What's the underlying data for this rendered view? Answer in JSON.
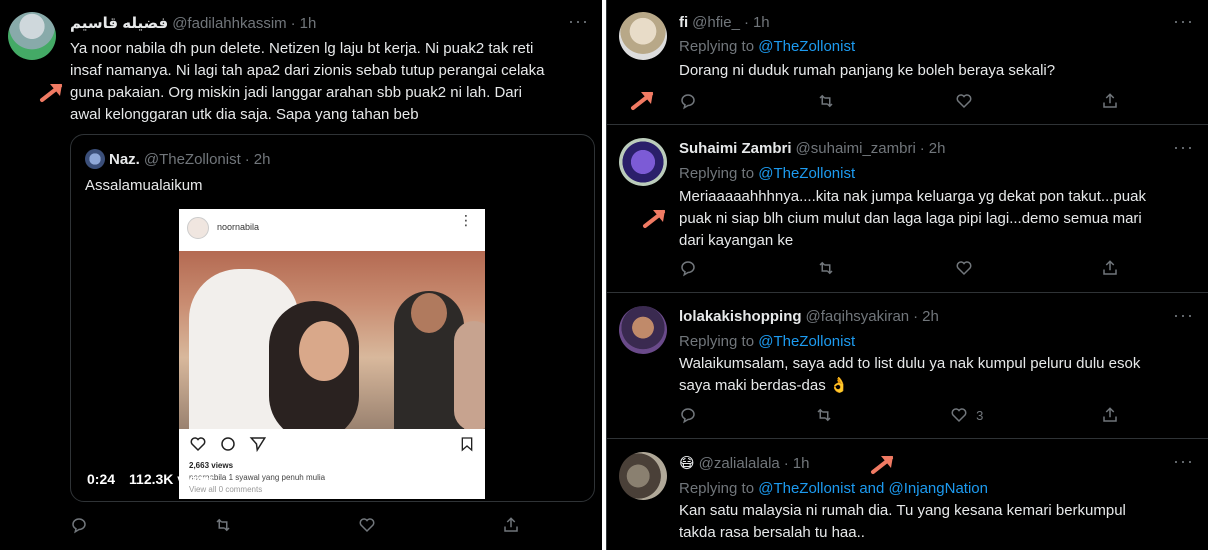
{
  "left_tweet": {
    "name": "فضيله قاسيم",
    "handle": "@fadilahhkassim",
    "time": "1h",
    "lines": [
      "Ya noor nabila dh pun delete. Netizen lg laju bt kerja. Ni puak2 tak reti",
      "insaf namanya. Ni lagi tah apa2 dari zionis sebab tutup perangai celaka",
      "guna pakaian. Org miskin jadi langgar arahan sbb puak2 ni lah. Dari",
      "awal kelonggaran utk dia saja. Sapa yang tahan beb"
    ],
    "quote": {
      "name": "Naz.",
      "handle": "@TheZollonist",
      "time": "2h",
      "text": "Assalamualaikum",
      "ig_username": "noornabila",
      "ig_views": "2,663 views",
      "ig_caption": "noornabila 1 syawal yang penuh mulia",
      "ig_comments": "View all 0 comments",
      "video_time": "0:24",
      "video_views": "112.3K views"
    }
  },
  "right_tweets": [
    {
      "name": "fi",
      "handle": "@hfie_",
      "time": "1h",
      "replying_label": "Replying to",
      "mentions": "@TheZollonist",
      "lines": [
        "Dorang ni duduk rumah panjang ke boleh beraya sekali?"
      ],
      "likes": ""
    },
    {
      "name": "Suhaimi Zambri",
      "handle": "@suhaimi_zambri",
      "time": "2h",
      "replying_label": "Replying to",
      "mentions": "@TheZollonist",
      "lines": [
        "Meriaaaaahhhnya....kita nak jumpa keluarga yg dekat pon takut...puak",
        "puak ni siap blh cium mulut dan laga laga pipi lagi...demo semua mari",
        "dari kayangan ke"
      ],
      "likes": ""
    },
    {
      "name": "lolakakishopping",
      "handle": "@faqihsyakiran",
      "time": "2h",
      "replying_label": "Replying to",
      "mentions": "@TheZollonist",
      "lines": [
        "Walaikumsalam, saya add to list dulu ya nak kumpul peluru dulu esok",
        "saya maki berdas-das 👌"
      ],
      "likes": "3"
    },
    {
      "name": "😷",
      "handle": "@zalialalala",
      "time": "1h",
      "replying_label": "Replying to",
      "mentions": "@TheZollonist and @InjangNation",
      "lines": [
        "Kan satu malaysia ni rumah dia. Tu yang kesana kemari berkumpul",
        "takda rasa bersalah tu haa.."
      ],
      "likes": ""
    }
  ],
  "colors": {
    "accent": "#1d9bf0",
    "muted": "#71767b",
    "arrow": "#f07a63"
  }
}
